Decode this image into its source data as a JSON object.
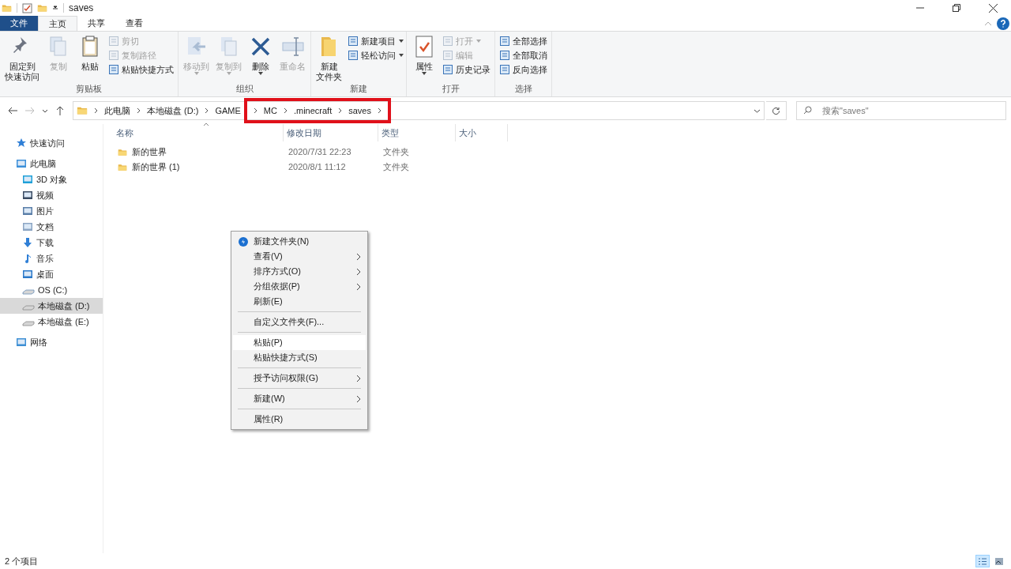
{
  "window": {
    "title": "saves"
  },
  "ribbon_tabs": [
    {
      "label": "文件",
      "kind": "file",
      "selected": false
    },
    {
      "label": "主页",
      "kind": "tab",
      "selected": true
    },
    {
      "label": "共享",
      "kind": "tab",
      "selected": false
    },
    {
      "label": "查看",
      "kind": "tab",
      "selected": false
    }
  ],
  "ribbon_groups": [
    {
      "label": "剪贴板",
      "columns": [
        [
          {
            "lines": [
              "固定到",
              "快速访问"
            ],
            "kind": "large",
            "disabled": false
          }
        ],
        [
          {
            "lines": [
              "复制"
            ],
            "kind": "large",
            "disabled": true
          }
        ],
        [
          {
            "lines": [
              "粘贴"
            ],
            "kind": "large",
            "disabled": false
          }
        ],
        [
          {
            "lines": [
              "剪切"
            ],
            "kind": "small",
            "disabled": true
          },
          {
            "lines": [
              "复制路径"
            ],
            "kind": "small",
            "disabled": true
          },
          {
            "lines": [
              "粘贴快捷方式"
            ],
            "kind": "small",
            "disabled": false
          }
        ]
      ]
    },
    {
      "label": "组织",
      "columns": [
        [
          {
            "lines": [
              "移动到"
            ],
            "kind": "large",
            "disabled": true,
            "dropdown": true
          }
        ],
        [
          {
            "lines": [
              "复制到"
            ],
            "kind": "large",
            "disabled": true,
            "dropdown": true
          }
        ],
        [
          {
            "lines": [
              "删除"
            ],
            "kind": "large",
            "disabled": false,
            "dropdown": true
          }
        ],
        [
          {
            "lines": [
              "重命名"
            ],
            "kind": "large",
            "disabled": true
          }
        ]
      ]
    },
    {
      "label": "新建",
      "columns": [
        [
          {
            "lines": [
              "新建",
              "文件夹"
            ],
            "kind": "large",
            "disabled": false
          }
        ],
        [
          {
            "lines": [
              "新建项目"
            ],
            "kind": "small",
            "disabled": false,
            "dropdown": true
          },
          {
            "lines": [
              "轻松访问"
            ],
            "kind": "small",
            "disabled": false,
            "dropdown": true
          }
        ]
      ]
    },
    {
      "label": "打开",
      "columns": [
        [
          {
            "lines": [
              "属性"
            ],
            "kind": "large",
            "disabled": false,
            "dropdown": true
          }
        ],
        [
          {
            "lines": [
              "打开"
            ],
            "kind": "small",
            "disabled": true,
            "dropdown": true
          },
          {
            "lines": [
              "编辑"
            ],
            "kind": "small",
            "disabled": true
          },
          {
            "lines": [
              "历史记录"
            ],
            "kind": "small",
            "disabled": false
          }
        ]
      ]
    },
    {
      "label": "选择",
      "columns": [
        [
          {
            "lines": [
              "全部选择"
            ],
            "kind": "small",
            "disabled": false
          },
          {
            "lines": [
              "全部取消"
            ],
            "kind": "small",
            "disabled": false
          },
          {
            "lines": [
              "反向选择"
            ],
            "kind": "small",
            "disabled": false
          }
        ]
      ]
    }
  ],
  "address": {
    "crumbs": [
      "此电脑",
      "本地磁盘 (D:)",
      "GAME"
    ],
    "highlighted_crumbs": [
      "MC",
      ".minecraft",
      "saves"
    ]
  },
  "search": {
    "placeholder": "搜索\"saves\""
  },
  "sidebar": {
    "items": [
      {
        "label": "快速访问",
        "selected": false
      },
      {
        "label": "此电脑",
        "selected": false,
        "children": [
          {
            "label": "3D 对象",
            "selected": false
          },
          {
            "label": "视频",
            "selected": false
          },
          {
            "label": "图片",
            "selected": false
          },
          {
            "label": "文档",
            "selected": false
          },
          {
            "label": "下载",
            "selected": false
          },
          {
            "label": "音乐",
            "selected": false
          },
          {
            "label": "桌面",
            "selected": false
          },
          {
            "label": "OS (C:)",
            "selected": false
          },
          {
            "label": "本地磁盘 (D:)",
            "selected": true
          },
          {
            "label": "本地磁盘 (E:)",
            "selected": false
          }
        ]
      },
      {
        "label": "网络",
        "selected": false
      }
    ]
  },
  "table": {
    "columns": [
      "名称",
      "修改日期",
      "类型",
      "大小"
    ],
    "rows": [
      {
        "name": "新的世界",
        "modified": "2020/7/31 22:23",
        "type": "文件夹"
      },
      {
        "name": "新的世界 (1)",
        "modified": "2020/8/1 11:12",
        "type": "文件夹"
      }
    ]
  },
  "context_menu": {
    "items": [
      {
        "kind": "item",
        "label": "新建文件夹(N)",
        "selected": false
      },
      {
        "kind": "item",
        "label": "查看(V)",
        "submenu": true,
        "selected": false
      },
      {
        "kind": "item",
        "label": "排序方式(O)",
        "submenu": true,
        "selected": false
      },
      {
        "kind": "item",
        "label": "分组依据(P)",
        "submenu": true,
        "selected": false
      },
      {
        "kind": "item",
        "label": "刷新(E)",
        "selected": false
      },
      {
        "kind": "separator"
      },
      {
        "kind": "item",
        "label": "自定义文件夹(F)...",
        "selected": false
      },
      {
        "kind": "separator"
      },
      {
        "kind": "item",
        "label": "粘贴(P)",
        "selected": true
      },
      {
        "kind": "item",
        "label": "粘贴快捷方式(S)",
        "selected": false
      },
      {
        "kind": "separator"
      },
      {
        "kind": "item",
        "label": "授予访问权限(G)",
        "submenu": true,
        "selected": false
      },
      {
        "kind": "separator"
      },
      {
        "kind": "item",
        "label": "新建(W)",
        "submenu": true,
        "selected": false
      },
      {
        "kind": "separator"
      },
      {
        "kind": "item",
        "label": "属性(R)",
        "selected": false
      }
    ]
  },
  "status_bar": {
    "text": "2 个项目",
    "views": [
      {
        "kind": "details",
        "selected": true
      },
      {
        "kind": "tiles",
        "selected": false
      }
    ]
  }
}
